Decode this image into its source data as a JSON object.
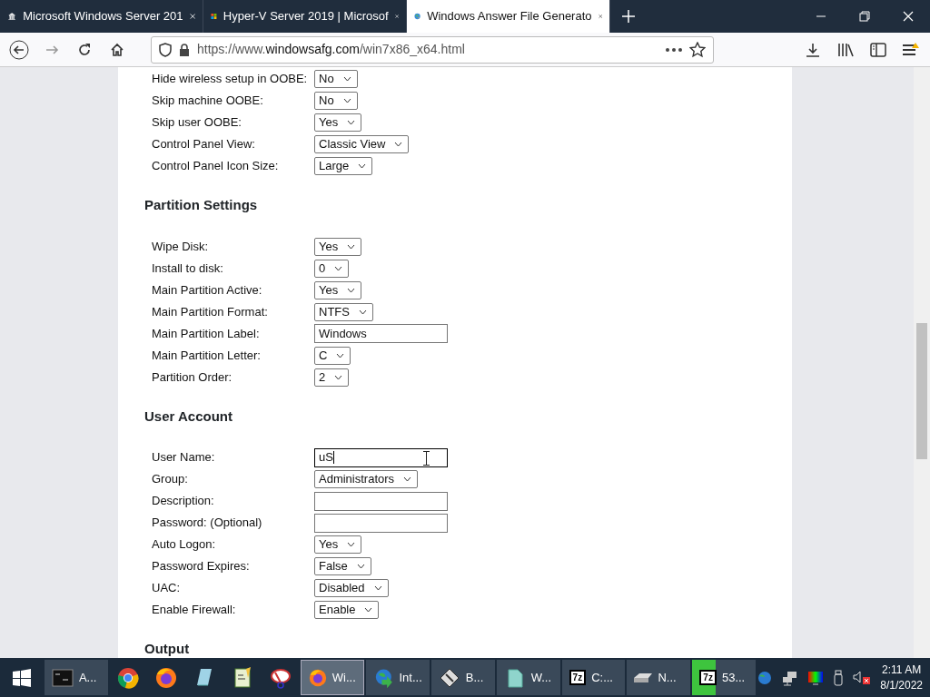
{
  "browser": {
    "tabs": [
      {
        "title": "Microsoft Windows Server 201",
        "kind": "building",
        "selected": false
      },
      {
        "title": "Hyper-V Server 2019 | Microsof",
        "kind": "windows",
        "selected": false
      },
      {
        "title": "Windows Answer File Generato",
        "kind": "globe",
        "selected": true
      }
    ],
    "url_prefix": "https://www.",
    "url_host": "windowsafg.com",
    "url_path": "/win7x86_x64.html"
  },
  "sections": [
    {
      "rows": [
        {
          "label": "Hide wireless setup in OOBE:",
          "kind": "select",
          "value": "No"
        },
        {
          "label": "Skip machine OOBE:",
          "kind": "select",
          "value": "No"
        },
        {
          "label": "Skip user OOBE:",
          "kind": "select",
          "value": "Yes"
        },
        {
          "label": "Control Panel View:",
          "kind": "select",
          "value": "Classic View"
        },
        {
          "label": "Control Panel Icon Size:",
          "kind": "select",
          "value": "Large"
        }
      ]
    },
    {
      "heading": "Partition Settings",
      "rows": [
        {
          "label": "Wipe Disk:",
          "kind": "select",
          "value": "Yes"
        },
        {
          "label": "Install to disk:",
          "kind": "select",
          "value": "0"
        },
        {
          "label": "Main Partition Active:",
          "kind": "select",
          "value": "Yes"
        },
        {
          "label": "Main Partition Format:",
          "kind": "select",
          "value": "NTFS"
        },
        {
          "label": "Main Partition Label:",
          "kind": "text",
          "value": "Windows",
          "focused": false
        },
        {
          "label": "Main Partition Letter:",
          "kind": "select",
          "value": "C"
        },
        {
          "label": "Partition Order:",
          "kind": "select",
          "value": "2"
        }
      ]
    },
    {
      "heading": "User Account",
      "rows": [
        {
          "label": "User Name:",
          "kind": "text",
          "value": "uS",
          "focused": true
        },
        {
          "label": "Group:",
          "kind": "select",
          "value": "Administrators"
        },
        {
          "label": "Description:",
          "kind": "text",
          "focused": false
        },
        {
          "label": "Password: (Optional)",
          "kind": "text",
          "focused": false
        },
        {
          "label": "Auto Logon:",
          "kind": "select",
          "value": "Yes"
        },
        {
          "label": "Password Expires:",
          "kind": "select",
          "value": "False"
        },
        {
          "label": "UAC:",
          "kind": "select",
          "value": "Disabled"
        },
        {
          "label": "Enable Firewall:",
          "kind": "select",
          "value": "Enable"
        }
      ]
    },
    {
      "heading": "Output"
    }
  ],
  "taskbar": {
    "items": [
      {
        "kind": "cmd",
        "label": "A...",
        "selected": false
      },
      {
        "kind": "chrome",
        "selected": false
      },
      {
        "kind": "firefox",
        "selected": false
      },
      {
        "kind": "notepad",
        "selected": false
      },
      {
        "kind": "editor",
        "selected": false
      },
      {
        "kind": "snip",
        "selected": false
      },
      {
        "kind": "firefox",
        "label": "Wi...",
        "selected": true
      },
      {
        "kind": "idm",
        "label": "Int...",
        "selected": false
      },
      {
        "kind": "disk",
        "label": "B...",
        "selected": false
      },
      {
        "kind": "file",
        "label": "W...",
        "selected": false
      },
      {
        "kind": "archiver",
        "icon_text": "7z",
        "label": "C:...",
        "selected": false
      },
      {
        "kind": "drive",
        "label": "N...",
        "selected": false
      },
      {
        "kind": "archiver",
        "icon_text": "7z",
        "label": "53...",
        "selected": false,
        "level": 0.36
      }
    ],
    "time": "2:11 AM",
    "date": "8/1/2022"
  }
}
